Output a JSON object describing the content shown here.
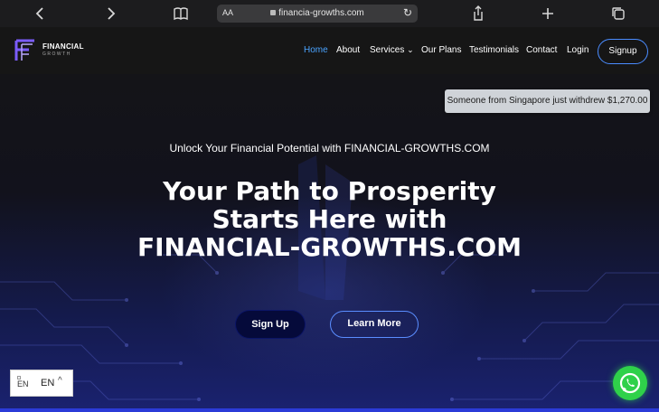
{
  "browser": {
    "aa_label": "AA",
    "url": "financia-growths.com",
    "back_icon": "chevron-left-icon",
    "forward_icon": "chevron-right-icon",
    "reader_icon": "book-icon",
    "reload_icon": "reload-icon",
    "share_icon": "share-icon",
    "new_tab_icon": "plus-icon",
    "tabs_icon": "tabs-icon"
  },
  "logo": {
    "line1": "FINANCIAL",
    "line2": "GROWTH",
    "accent_color": "#7b5cff"
  },
  "nav": {
    "items": [
      "Home",
      "About",
      "Services",
      "Our Plans",
      "Testimonials",
      "Contact",
      "Login"
    ],
    "services_caret": "⌄",
    "signup": "Signup",
    "active_color": "#4aa3ff"
  },
  "toast": {
    "text": "Someone from Singapore just withdrew $1,270.00"
  },
  "hero": {
    "tagline": "Unlock Your Financial Potential with FINANCIAL-GROWTHS.COM",
    "headline": "Your Path to Prosperity Starts Here with FINANCIAL-GROWTHS.COM",
    "primary_button": "Sign Up",
    "secondary_button": "Learn More"
  },
  "language": {
    "flag_alt": "EN",
    "code": "EN",
    "caret": "^"
  },
  "whatsapp": {
    "icon": "whatsapp-icon",
    "color": "#2fd14a"
  }
}
